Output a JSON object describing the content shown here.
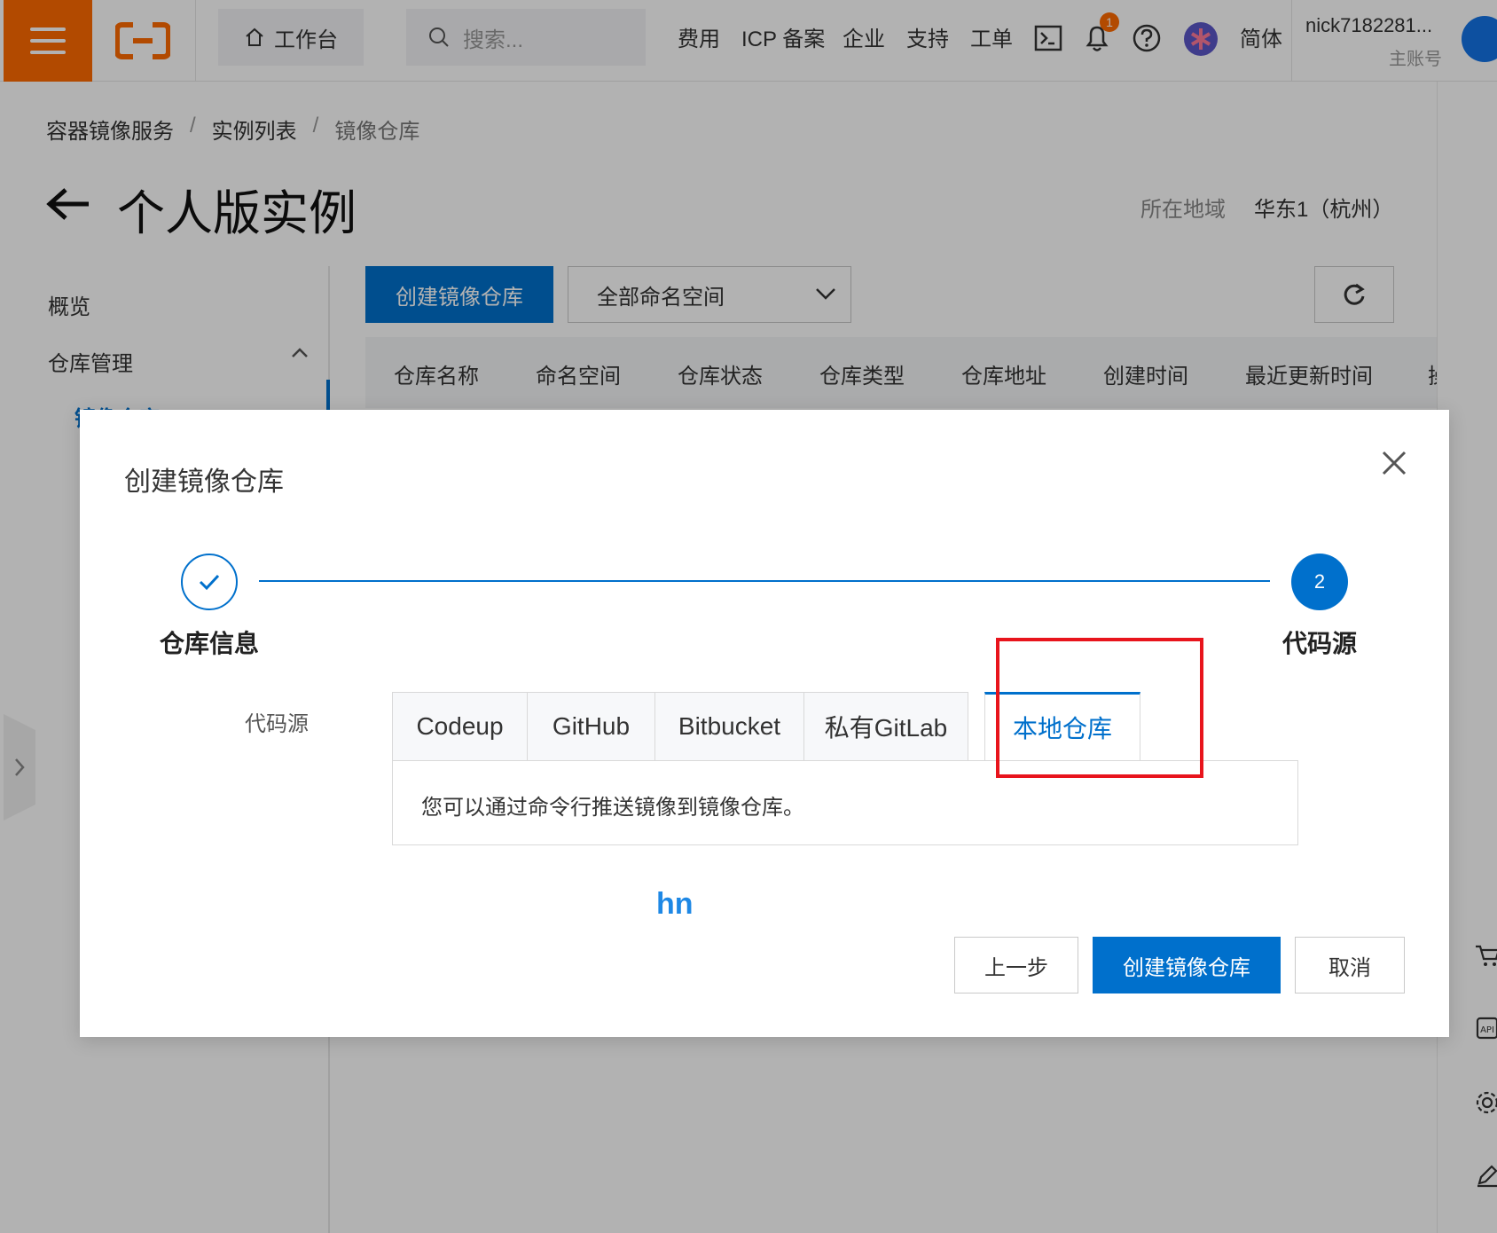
{
  "topbar": {
    "workbench": "工作台",
    "search_placeholder": "搜索...",
    "nav": [
      "费用",
      "ICP 备案",
      "企业",
      "支持",
      "工单"
    ],
    "notification_count": "1",
    "language": "简体",
    "user_name": "nick7182281...",
    "user_role": "主账号",
    "accent_color": "#ff6a00"
  },
  "breadcrumb": [
    "容器镜像服务",
    "实例列表",
    "镜像仓库"
  ],
  "breadcrumb_sep": "/",
  "page": {
    "title": "个人版实例",
    "region_label": "所在地域",
    "region_value": "华东1（杭州）"
  },
  "sidebar": {
    "items": [
      "概览",
      "仓库管理"
    ],
    "sub_item": "镜像仓库"
  },
  "toolbar": {
    "create_button": "创建镜像仓库",
    "namespace_select": "全部命名空间"
  },
  "table": {
    "columns": [
      "仓库名称",
      "命名空间",
      "仓库状态",
      "仓库类型",
      "仓库地址",
      "创建时间",
      "最近更新时间",
      "操"
    ]
  },
  "modal": {
    "title": "创建镜像仓库",
    "steps": [
      {
        "label": "仓库信息",
        "state": "done"
      },
      {
        "label": "代码源",
        "state": "current",
        "number": "2"
      }
    ],
    "field_label": "代码源",
    "tabs": [
      "Codeup",
      "GitHub",
      "Bitbucket",
      "私有GitLab",
      "本地仓库"
    ],
    "active_tab": "本地仓库",
    "panel_text": "您可以通过命令行推送镜像到镜像仓库。",
    "hint": "hn",
    "buttons": {
      "prev": "上一步",
      "create": "创建镜像仓库",
      "cancel": "取消"
    }
  },
  "colors": {
    "primary": "#0070cc",
    "annotation": "#e8141c",
    "hint": "#1e88e5"
  }
}
